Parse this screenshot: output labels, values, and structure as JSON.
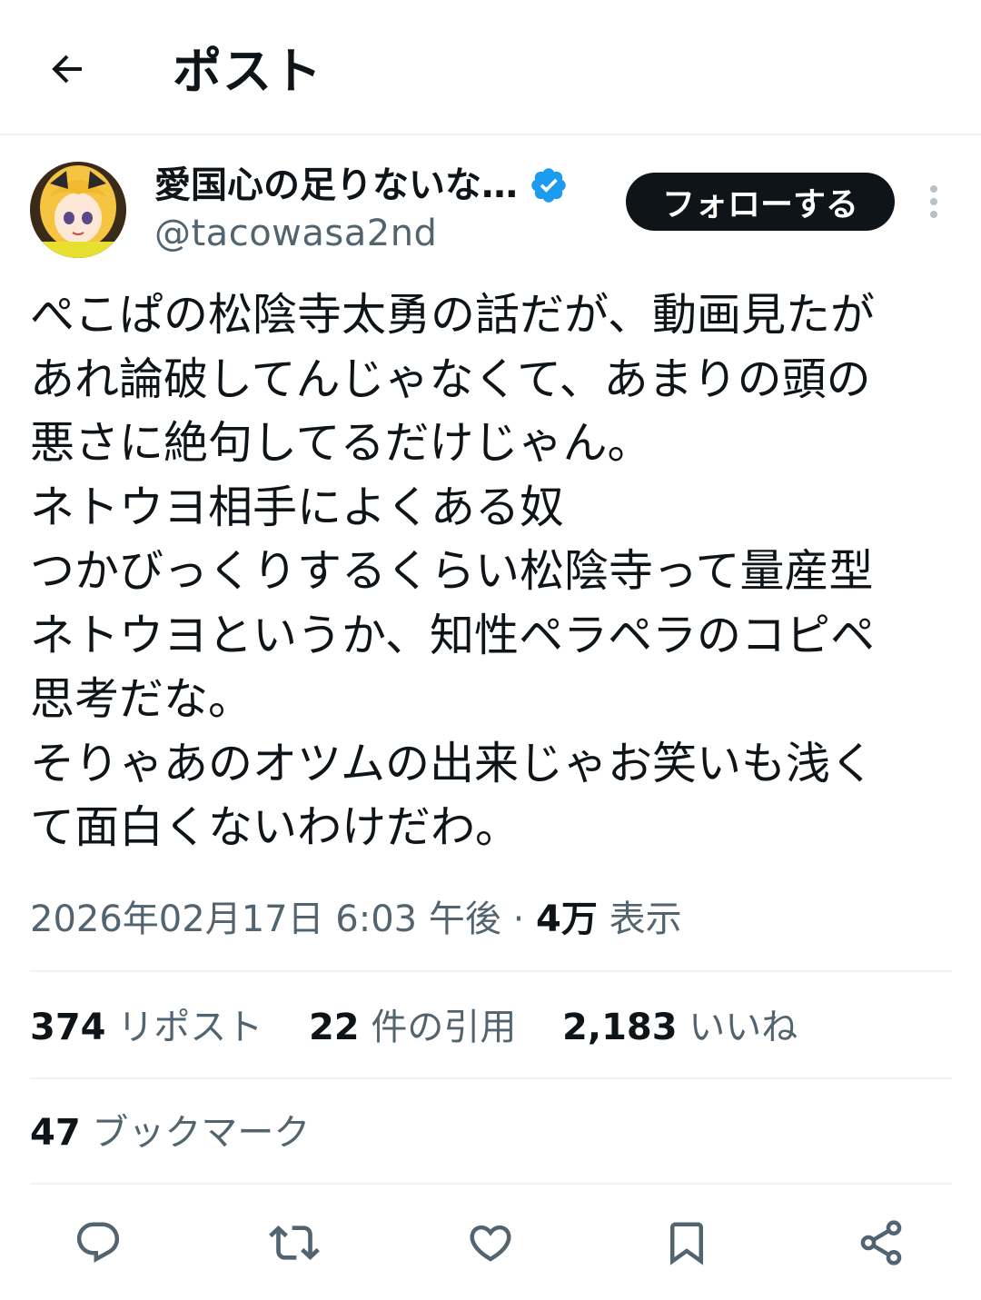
{
  "header": {
    "title": "ポスト"
  },
  "author": {
    "display_name": "愛国心の足りないな…",
    "handle": "@tacowasa2nd",
    "verified": true,
    "follow_label": "フォローする"
  },
  "tweet": {
    "text": "ぺこぱの松陰寺太勇の話だが、動画見たが\nあれ論破してんじゃなくて、あまりの頭の\n悪さに絶句してるだけじゃん。\nネトウヨ相手によくある奴\nつかびっくりするくらい松陰寺って量産型\nネトウヨというか、知性ペラペラのコピペ\n思考だな。\nそりゃあのオツムの出来じゃお笑いも浅く\nて面白くないわけだわ。",
    "timestamp": "2026年02月17日 6:03 午後",
    "separator": "·",
    "views_count": "4万",
    "views_label": "表示"
  },
  "stats": {
    "reposts_count": "374",
    "reposts_label": "リポスト",
    "quotes_count": "22",
    "quotes_label": "件の引用",
    "likes_count": "2,183",
    "likes_label": "いいね",
    "bookmarks_count": "47",
    "bookmarks_label": "ブックマーク"
  },
  "actions": [
    "reply-icon",
    "repost-icon",
    "like-icon",
    "bookmark-icon",
    "share-icon"
  ],
  "colors": {
    "text": "#0f1419",
    "secondary": "#536471",
    "verified": "#1d9bf0",
    "divider": "#eff3f4"
  }
}
